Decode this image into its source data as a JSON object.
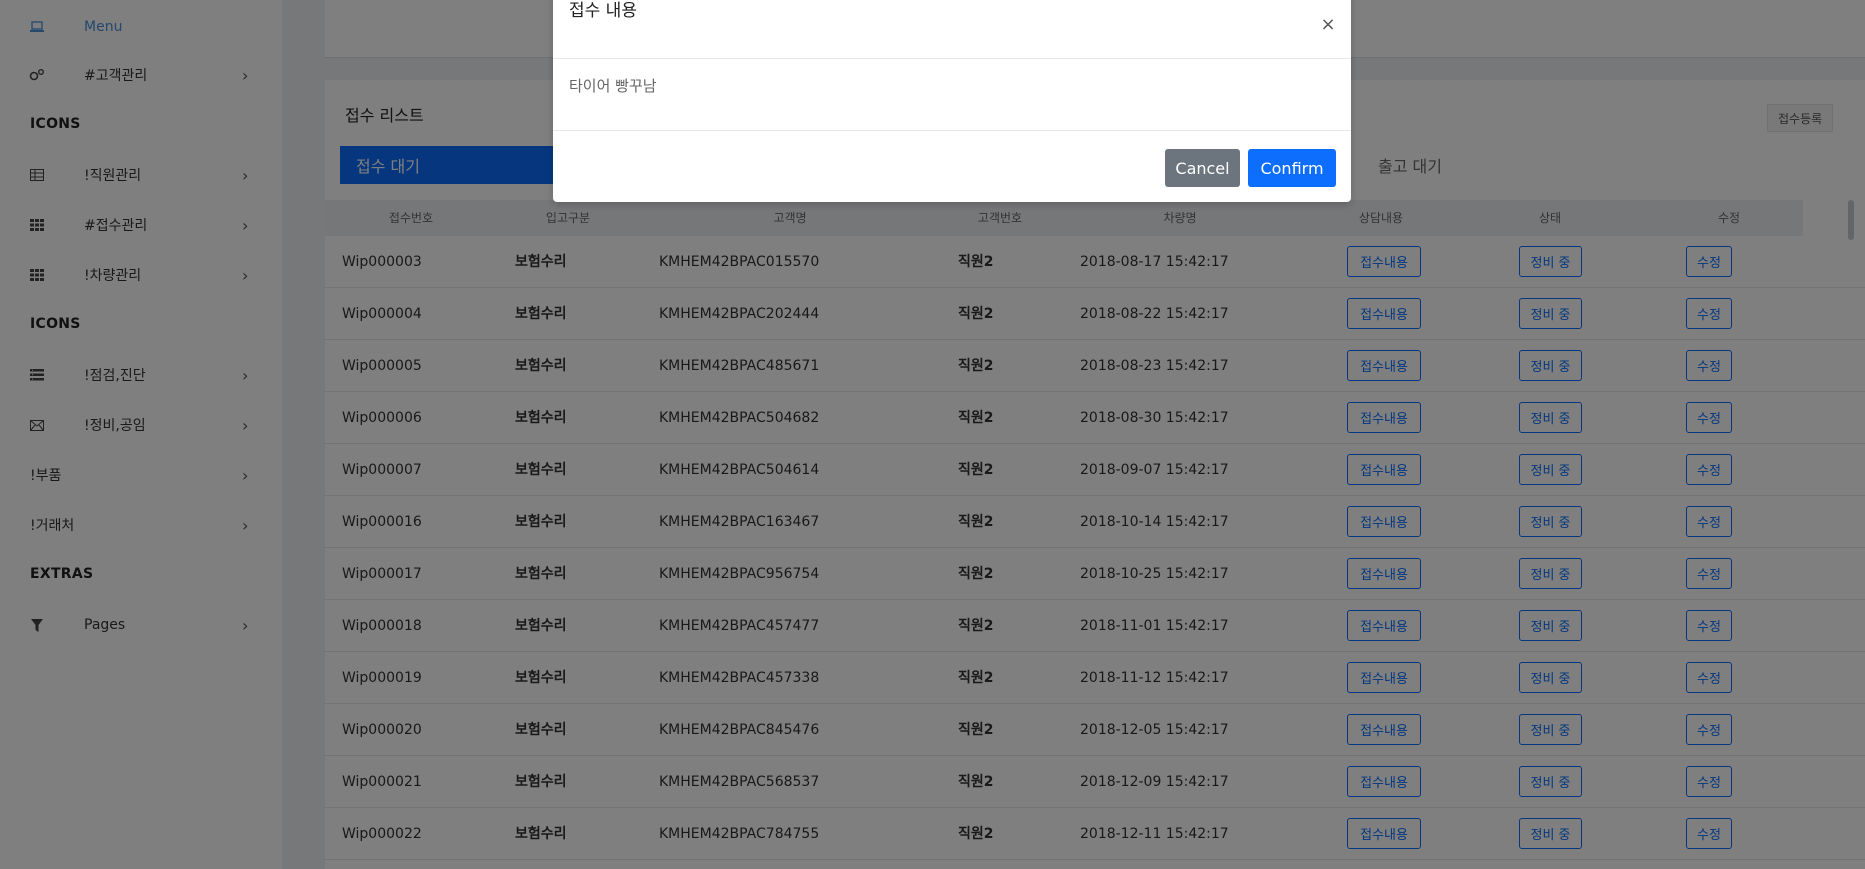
{
  "sidebar": {
    "menu_label": "Menu",
    "sections": [
      {
        "heading": "ICONS"
      },
      {
        "heading": "ICONS"
      },
      {
        "heading": "EXTRAS"
      }
    ],
    "items": [
      {
        "label": "#고객관리",
        "icon": "gears-icon"
      },
      {
        "label": "!직원관리",
        "icon": "table-icon"
      },
      {
        "label": "#접수관리",
        "icon": "grid-icon"
      },
      {
        "label": "!차량관리",
        "icon": "grid-icon"
      },
      {
        "label": "!점검,진단",
        "icon": "list-icon"
      },
      {
        "label": "!정비,공임",
        "icon": "envelope-icon"
      },
      {
        "label": "!부품",
        "icon": ""
      },
      {
        "label": "!거래처",
        "icon": ""
      },
      {
        "label": "Pages",
        "icon": "filter-icon"
      }
    ]
  },
  "panel": {
    "title": "접수 리스트",
    "register_label": "접수등록",
    "tab_active": "접수 대기",
    "tab_other": "출고 대기"
  },
  "table": {
    "headers": [
      "접수번호",
      "입고구분",
      "고객명",
      "고객번호",
      "차량명",
      "상담내용",
      "상태",
      "수정"
    ],
    "button_labels": {
      "consult": "접수내용",
      "status": "정비 중",
      "edit": "수정"
    },
    "rows": [
      {
        "id": "Wip000003",
        "type": "보험수리",
        "vin": "KMHEM42BPAC015570",
        "staff": "직원2",
        "date": "2018-08-17 15:42:17"
      },
      {
        "id": "Wip000004",
        "type": "보험수리",
        "vin": "KMHEM42BPAC202444",
        "staff": "직원2",
        "date": "2018-08-22 15:42:17"
      },
      {
        "id": "Wip000005",
        "type": "보험수리",
        "vin": "KMHEM42BPAC485671",
        "staff": "직원2",
        "date": "2018-08-23 15:42:17"
      },
      {
        "id": "Wip000006",
        "type": "보험수리",
        "vin": "KMHEM42BPAC504682",
        "staff": "직원2",
        "date": "2018-08-30 15:42:17"
      },
      {
        "id": "Wip000007",
        "type": "보험수리",
        "vin": "KMHEM42BPAC504614",
        "staff": "직원2",
        "date": "2018-09-07 15:42:17"
      },
      {
        "id": "Wip000016",
        "type": "보험수리",
        "vin": "KMHEM42BPAC163467",
        "staff": "직원2",
        "date": "2018-10-14 15:42:17"
      },
      {
        "id": "Wip000017",
        "type": "보험수리",
        "vin": "KMHEM42BPAC956754",
        "staff": "직원2",
        "date": "2018-10-25 15:42:17"
      },
      {
        "id": "Wip000018",
        "type": "보험수리",
        "vin": "KMHEM42BPAC457477",
        "staff": "직원2",
        "date": "2018-11-01 15:42:17"
      },
      {
        "id": "Wip000019",
        "type": "보험수리",
        "vin": "KMHEM42BPAC457338",
        "staff": "직원2",
        "date": "2018-11-12 15:42:17"
      },
      {
        "id": "Wip000020",
        "type": "보험수리",
        "vin": "KMHEM42BPAC845476",
        "staff": "직원2",
        "date": "2018-12-05 15:42:17"
      },
      {
        "id": "Wip000021",
        "type": "보험수리",
        "vin": "KMHEM42BPAC568537",
        "staff": "직원2",
        "date": "2018-12-09 15:42:17"
      },
      {
        "id": "Wip000022",
        "type": "보험수리",
        "vin": "KMHEM42BPAC784755",
        "staff": "직원2",
        "date": "2018-12-11 15:42:17"
      }
    ]
  },
  "modal": {
    "title": "접수 내용",
    "body": "타이어 빵꾸남",
    "close_symbol": "×",
    "cancel_label": "Cancel",
    "confirm_label": "Confirm"
  }
}
